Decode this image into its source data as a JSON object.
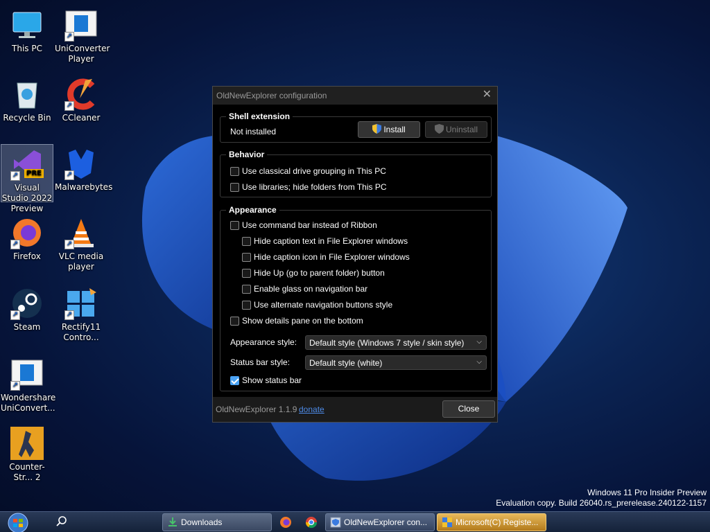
{
  "desktop_icons": [
    {
      "label": "This PC",
      "icon": "this-pc-icon"
    },
    {
      "label": "UniConverter Player",
      "icon": "uniconverter-icon"
    },
    {
      "label": "Recycle Bin",
      "icon": "recycle-bin-icon"
    },
    {
      "label": "CCleaner",
      "icon": "ccleaner-icon"
    },
    {
      "label": "Visual Studio 2022 Preview",
      "icon": "visual-studio-icon",
      "badge": "PRE"
    },
    {
      "label": "Malwarebytes",
      "icon": "malwarebytes-icon"
    },
    {
      "label": "Firefox",
      "icon": "firefox-icon"
    },
    {
      "label": "VLC media player",
      "icon": "vlc-icon"
    },
    {
      "label": "Steam",
      "icon": "steam-icon"
    },
    {
      "label": "Rectify11 Contro...",
      "icon": "rectify11-icon"
    },
    {
      "label": "Wondershare UniConvert...",
      "icon": "wondershare-icon"
    },
    {
      "label": "Counter-Str... 2",
      "icon": "counter-strike-icon"
    }
  ],
  "dialog": {
    "title": "OldNewExplorer configuration",
    "shell_extension": {
      "title": "Shell extension",
      "status": "Not installed",
      "install_label": "Install",
      "uninstall_label": "Uninstall"
    },
    "behavior": {
      "title": "Behavior",
      "options": [
        {
          "label": "Use classical drive grouping in This PC",
          "checked": false
        },
        {
          "label": "Use libraries; hide folders from This PC",
          "checked": false
        }
      ]
    },
    "appearance": {
      "title": "Appearance",
      "command_bar": "Use command bar instead of Ribbon",
      "sub_options": [
        "Hide caption text in File Explorer windows",
        "Hide caption icon in File Explorer windows",
        "Hide Up (go to parent folder) button",
        "Enable glass on navigation bar",
        "Use alternate navigation buttons style"
      ],
      "details_pane": "Show details pane on the bottom",
      "appearance_style_label": "Appearance style:",
      "appearance_style_value": "Default style (Windows 7 style / skin style)",
      "status_bar_style_label": "Status bar style:",
      "status_bar_style_value": "Default style (white)",
      "show_status_bar": "Show status bar"
    },
    "version": "OldNewExplorer 1.1.9",
    "donate": "donate",
    "close_label": "Close"
  },
  "watermark": {
    "line1": "Windows 11 Pro Insider Preview",
    "line2": "Evaluation copy. Build 26040.rs_prerelease.240122-1157"
  },
  "taskbar": {
    "downloads": "Downloads",
    "oldnew": "OldNewExplorer con...",
    "registry": "Microsoft(C) Registe..."
  },
  "colors": {
    "accent": "#4aa3f5",
    "link": "#4d8ae6",
    "active_task": "#e7b85a"
  }
}
